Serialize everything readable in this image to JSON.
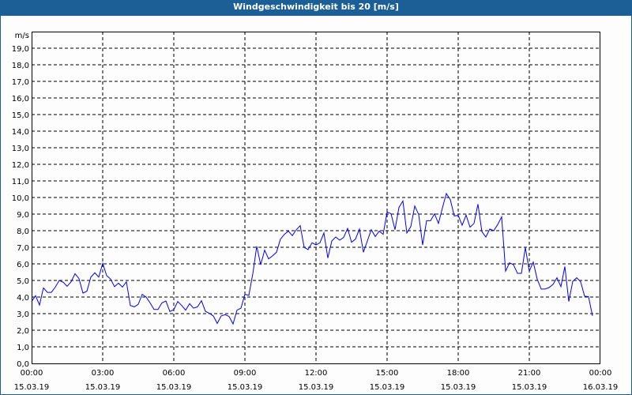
{
  "window": {
    "title": "Windgeschwindigkeit bis 20 [m/s]"
  },
  "colors": {
    "titlebar": "#1c5f96",
    "line": "#0000ff",
    "grid": "#000000"
  },
  "chart_data": {
    "type": "line",
    "title": "Windgeschwindigkeit bis 20 [m/s]",
    "ylabel": "m/s",
    "xlabel": "",
    "ylim": [
      0,
      20
    ],
    "xlim_hours": [
      0,
      24
    ],
    "grid": true,
    "y_ticks": [
      "0,0",
      "1,0",
      "2,0",
      "3,0",
      "4,0",
      "5,0",
      "6,0",
      "7,0",
      "8,0",
      "9,0",
      "10,0",
      "11,0",
      "12,0",
      "13,0",
      "14,0",
      "15,0",
      "16,0",
      "17,0",
      "18,0",
      "19,0"
    ],
    "x_ticks": [
      {
        "time": "00:00",
        "date": "15.03.19"
      },
      {
        "time": "03:00",
        "date": "15.03.19"
      },
      {
        "time": "06:00",
        "date": "15.03.19"
      },
      {
        "time": "09:00",
        "date": "15.03.19"
      },
      {
        "time": "12:00",
        "date": "15.03.19"
      },
      {
        "time": "15:00",
        "date": "15.03.19"
      },
      {
        "time": "18:00",
        "date": "15.03.19"
      },
      {
        "time": "21:00",
        "date": "15.03.19"
      },
      {
        "time": "00:00",
        "date": "16.03.19"
      }
    ],
    "sample_interval_minutes": 10,
    "series": [
      {
        "name": "Windgeschwindigkeit",
        "values": [
          3.73,
          4.08,
          3.52,
          4.55,
          4.28,
          4.28,
          4.6,
          5.0,
          4.89,
          4.65,
          4.92,
          5.41,
          5.11,
          4.24,
          4.35,
          5.2,
          5.46,
          5.2,
          6.03,
          5.29,
          5.08,
          4.63,
          4.84,
          4.6,
          4.92,
          3.49,
          3.41,
          3.56,
          4.16,
          4.0,
          3.65,
          3.25,
          3.25,
          3.65,
          3.76,
          3.13,
          3.24,
          3.73,
          3.49,
          3.21,
          3.6,
          3.33,
          3.41,
          3.78,
          3.14,
          3.02,
          2.86,
          2.41,
          2.86,
          2.94,
          2.83,
          2.38,
          3.21,
          3.33,
          4.16,
          4.1,
          5.4,
          7.06,
          5.95,
          6.83,
          6.3,
          6.48,
          6.7,
          7.49,
          7.78,
          7.97,
          7.7,
          8.05,
          8.3,
          7.0,
          6.86,
          7.27,
          7.14,
          7.27,
          7.86,
          6.35,
          7.38,
          7.62,
          7.43,
          7.59,
          8.14,
          7.3,
          7.49,
          8.1,
          6.7,
          7.38,
          8.06,
          7.65,
          7.97,
          7.78,
          9.13,
          9.02,
          8.06,
          9.4,
          9.79,
          7.86,
          8.25,
          9.49,
          8.97,
          7.14,
          8.6,
          8.6,
          9.02,
          8.44,
          9.37,
          10.24,
          9.87,
          8.89,
          8.92,
          8.33,
          8.94,
          8.21,
          8.44,
          9.6,
          7.94,
          7.62,
          8.1,
          8.0,
          8.37,
          8.84,
          5.56,
          6.06,
          5.95,
          5.43,
          5.43,
          6.98,
          5.56,
          6.11,
          5.08,
          4.48,
          4.48,
          4.57,
          4.76,
          5.16,
          4.63,
          5.84,
          3.73,
          4.95,
          5.16,
          4.92,
          4.05,
          4.02,
          2.86
        ]
      }
    ]
  }
}
